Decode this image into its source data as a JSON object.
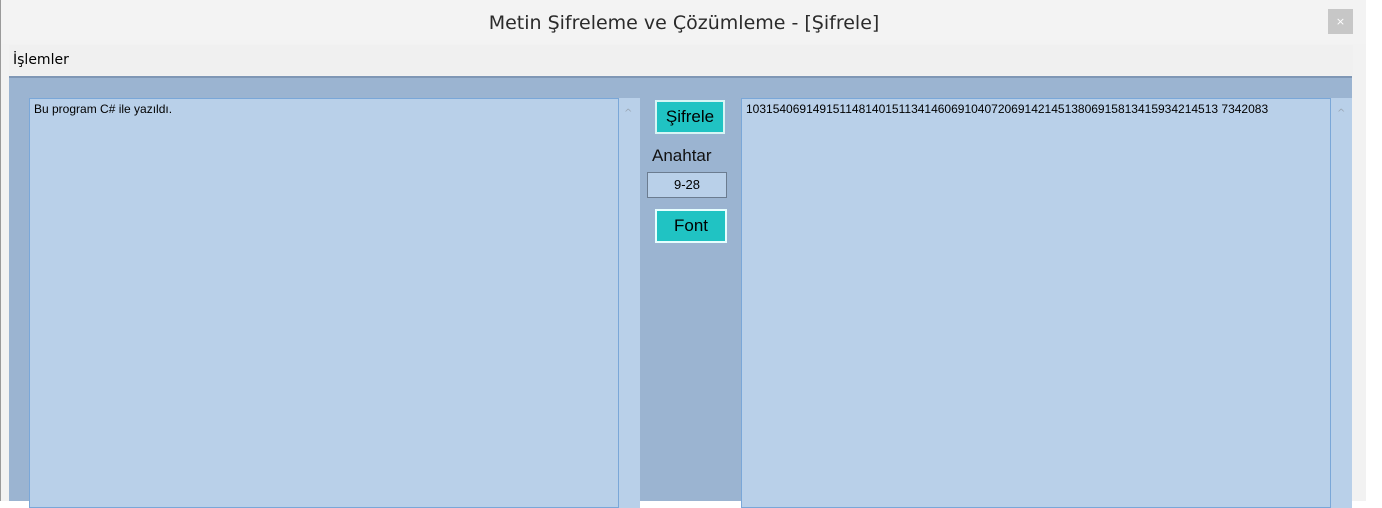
{
  "window": {
    "title": "Metin Şifreleme ve Çözümleme - [Şifrele]",
    "close_symbol": "×"
  },
  "menu": {
    "items": [
      "İşlemler"
    ]
  },
  "input": {
    "text": "Bu program C# ile yazıldı."
  },
  "controls": {
    "encrypt_label": "Şifrele",
    "key_label": "Anahtar",
    "key_value": "9-28",
    "font_label": "Font"
  },
  "output": {
    "text": "10315406914915114814015113414606910407206914214513806915813415934214513 7342083"
  },
  "scroll_symbol": "^",
  "colors": {
    "panel": "#9bb4d1",
    "textbox": "#b9d0e9",
    "button": "#20c3c3"
  }
}
